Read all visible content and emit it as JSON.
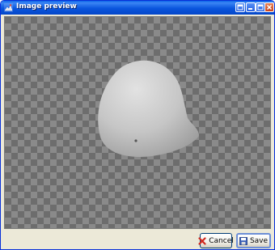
{
  "window": {
    "title": "Image preview",
    "accent_color": "#0a55dd"
  },
  "titlebar_buttons": [
    {
      "name": "help-button",
      "icon": "question-icon"
    },
    {
      "name": "minimize-button",
      "icon": "minimize-icon"
    },
    {
      "name": "maximize-button",
      "icon": "maximize-icon"
    },
    {
      "name": "close-button",
      "icon": "close-icon"
    }
  ],
  "preview": {
    "background": "checkerboard",
    "subject": "grey-3d-shape"
  },
  "actions": {
    "cancel_label": "Cancel",
    "save_label": "Save"
  }
}
